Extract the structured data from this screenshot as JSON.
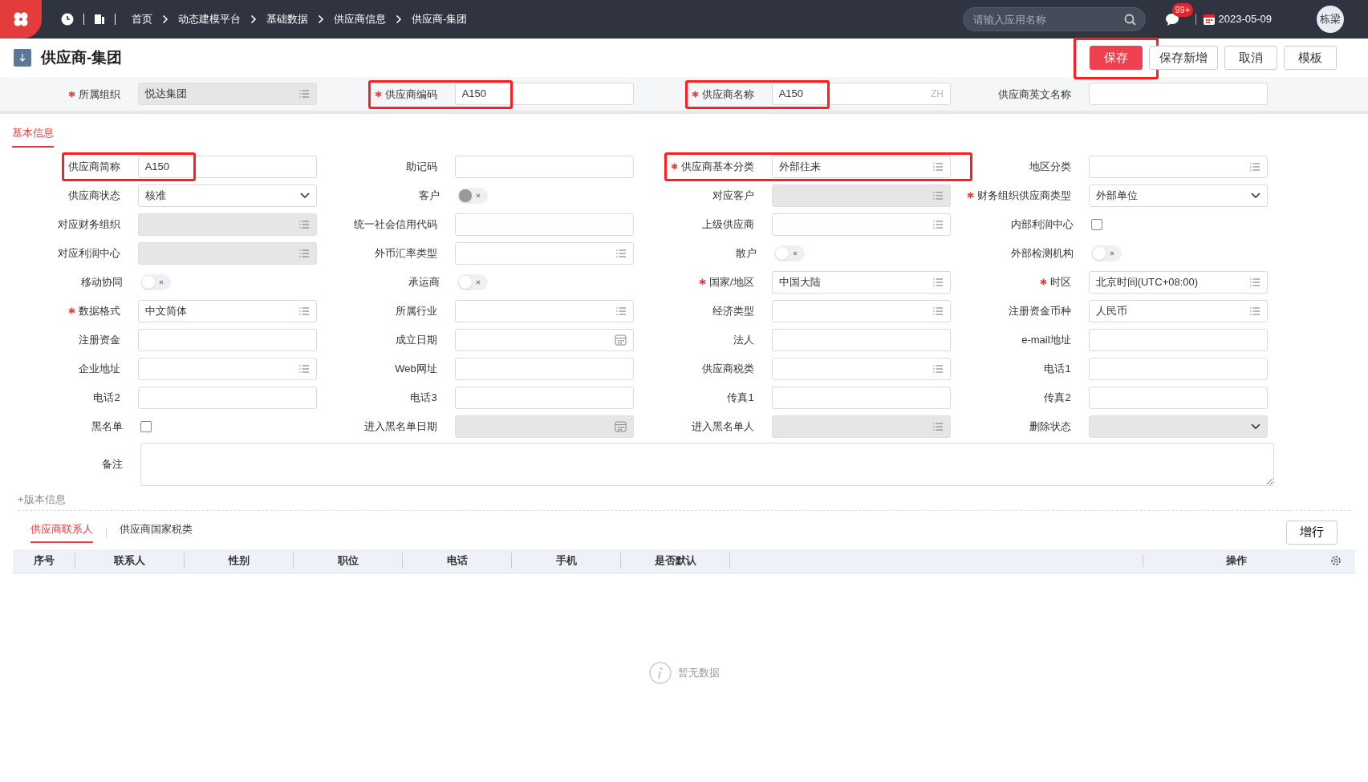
{
  "topbar": {
    "breadcrumbs": [
      "首页",
      "动态建模平台",
      "基础数据",
      "供应商信息",
      "供应商-集团"
    ],
    "search": {
      "placeholder": "请输入应用名称"
    },
    "badge": "99+",
    "date": "2023-05-09",
    "user": "栋梁"
  },
  "page": {
    "title": "供应商-集团",
    "buttons": [
      {
        "label": "保存",
        "primary": true,
        "highlighted": true
      },
      {
        "label": "保存新增",
        "primary": false,
        "highlighted": false
      },
      {
        "label": "取消",
        "primary": false,
        "highlighted": false
      },
      {
        "label": "模板",
        "primary": false,
        "highlighted": false
      }
    ]
  },
  "header_fields": [
    {
      "label": "所属组织",
      "kind": "list",
      "value": "悦达集团",
      "required": true,
      "disabled": true,
      "highlighted": false
    },
    {
      "label": "供应商编码",
      "kind": "text",
      "value": "A150",
      "required": true,
      "disabled": false,
      "highlighted": true
    },
    {
      "label": "供应商名称",
      "kind": "text",
      "value": "A150",
      "suffix": "ZH",
      "required": true,
      "disabled": false,
      "highlighted": true
    },
    {
      "label": "供应商英文名称",
      "kind": "text",
      "required": false,
      "disabled": false,
      "highlighted": false
    }
  ],
  "tabs": [
    {
      "label": "基本信息",
      "selected": true
    }
  ],
  "fields": [
    {
      "label": "供应商简称",
      "kind": "text",
      "value": "A150",
      "required": false,
      "disabled": false,
      "highlighted": true
    },
    {
      "label": "助记码",
      "kind": "text",
      "required": false,
      "disabled": false,
      "highlighted": false
    },
    {
      "label": "供应商基本分类",
      "kind": "list",
      "value": "外部往来",
      "required": true,
      "disabled": false,
      "highlighted": true
    },
    {
      "label": "地区分类",
      "kind": "list",
      "required": false,
      "disabled": false,
      "highlighted": false
    },
    {
      "label": "供应商状态",
      "kind": "select",
      "value": "核准",
      "required": false,
      "disabled": false,
      "highlighted": false
    },
    {
      "label": "客户",
      "kind": "toggle",
      "on": false,
      "required": false,
      "disabled": true,
      "highlighted": false
    },
    {
      "label": "对应客户",
      "kind": "list",
      "required": false,
      "disabled": true,
      "highlighted": false
    },
    {
      "label": "财务组织供应商类型",
      "kind": "select",
      "value": "外部单位",
      "required": true,
      "disabled": false,
      "highlighted": false
    },
    {
      "label": "对应财务组织",
      "kind": "list",
      "required": false,
      "disabled": true,
      "highlighted": false
    },
    {
      "label": "统一社会信用代码",
      "kind": "text",
      "required": false,
      "disabled": false,
      "highlighted": false
    },
    {
      "label": "上级供应商",
      "kind": "list",
      "required": false,
      "disabled": false,
      "highlighted": false
    },
    {
      "label": "内部利润中心",
      "kind": "checkbox",
      "checked": false,
      "required": false,
      "disabled": false,
      "highlighted": false
    },
    {
      "label": "对应利润中心",
      "kind": "list",
      "required": false,
      "disabled": true,
      "highlighted": false
    },
    {
      "label": "外币汇率类型",
      "kind": "list",
      "required": false,
      "disabled": false,
      "highlighted": false
    },
    {
      "label": "散户",
      "kind": "toggle",
      "on": false,
      "required": false,
      "disabled": false,
      "highlighted": false
    },
    {
      "label": "外部检测机构",
      "kind": "toggle",
      "on": false,
      "required": false,
      "disabled": false,
      "highlighted": false
    },
    {
      "label": "移动协同",
      "kind": "toggle",
      "on": false,
      "required": false,
      "disabled": false,
      "highlighted": false
    },
    {
      "label": "承运商",
      "kind": "toggle",
      "on": false,
      "required": false,
      "disabled": false,
      "highlighted": false
    },
    {
      "label": "国家/地区",
      "kind": "list",
      "value": "中国大陆",
      "required": true,
      "disabled": false,
      "highlighted": false
    },
    {
      "label": "时区",
      "kind": "list",
      "value": "北京时间(UTC+08:00)",
      "required": true,
      "disabled": false,
      "highlighted": false
    },
    {
      "label": "数据格式",
      "kind": "list",
      "value": "中文简体",
      "required": true,
      "disabled": false,
      "highlighted": false
    },
    {
      "label": "所属行业",
      "kind": "list",
      "required": false,
      "disabled": false,
      "highlighted": false
    },
    {
      "label": "经济类型",
      "kind": "list",
      "required": false,
      "disabled": false,
      "highlighted": false
    },
    {
      "label": "注册资金币种",
      "kind": "list",
      "value": "人民币",
      "required": false,
      "disabled": false,
      "highlighted": false
    },
    {
      "label": "注册资金",
      "kind": "text",
      "required": false,
      "disabled": false,
      "highlighted": false
    },
    {
      "label": "成立日期",
      "kind": "date",
      "required": false,
      "disabled": false,
      "highlighted": false
    },
    {
      "label": "法人",
      "kind": "text",
      "required": false,
      "disabled": false,
      "highlighted": false
    },
    {
      "label": "e-mail地址",
      "kind": "text",
      "required": false,
      "disabled": false,
      "highlighted": false
    },
    {
      "label": "企业地址",
      "kind": "list",
      "required": false,
      "disabled": false,
      "highlighted": false
    },
    {
      "label": "Web网址",
      "kind": "text",
      "required": false,
      "disabled": false,
      "highlighted": false
    },
    {
      "label": "供应商税类",
      "kind": "list",
      "required": false,
      "disabled": false,
      "highlighted": false
    },
    {
      "label": "电话1",
      "kind": "text",
      "required": false,
      "disabled": false,
      "highlighted": false
    },
    {
      "label": "电话2",
      "kind": "text",
      "required": false,
      "disabled": false,
      "highlighted": false
    },
    {
      "label": "电话3",
      "kind": "text",
      "required": false,
      "disabled": false,
      "highlighted": false
    },
    {
      "label": "传真1",
      "kind": "text",
      "required": false,
      "disabled": false,
      "highlighted": false
    },
    {
      "label": "传真2",
      "kind": "text",
      "required": false,
      "disabled": false,
      "highlighted": false
    },
    {
      "label": "黑名单",
      "kind": "checkbox",
      "checked": false,
      "required": false,
      "disabled": false,
      "highlighted": false
    },
    {
      "label": "进入黑名单日期",
      "kind": "date",
      "required": false,
      "disabled": true,
      "highlighted": false
    },
    {
      "label": "进入黑名单人",
      "kind": "list",
      "required": false,
      "disabled": true,
      "highlighted": false
    },
    {
      "label": "删除状态",
      "kind": "select",
      "required": false,
      "disabled": true,
      "highlighted": false
    }
  ],
  "remark": {
    "label": "备注"
  },
  "version_link": "+版本信息",
  "sub_tabs": [
    {
      "label": "供应商联系人",
      "selected": true
    },
    {
      "label": "供应商国家税类",
      "selected": false
    }
  ],
  "add_row_button": "增行",
  "table": {
    "columns": [
      "序号",
      "联系人",
      "性别",
      "职位",
      "电话",
      "手机",
      "是否默认",
      "操作"
    ],
    "empty_text": "暂无数据"
  }
}
